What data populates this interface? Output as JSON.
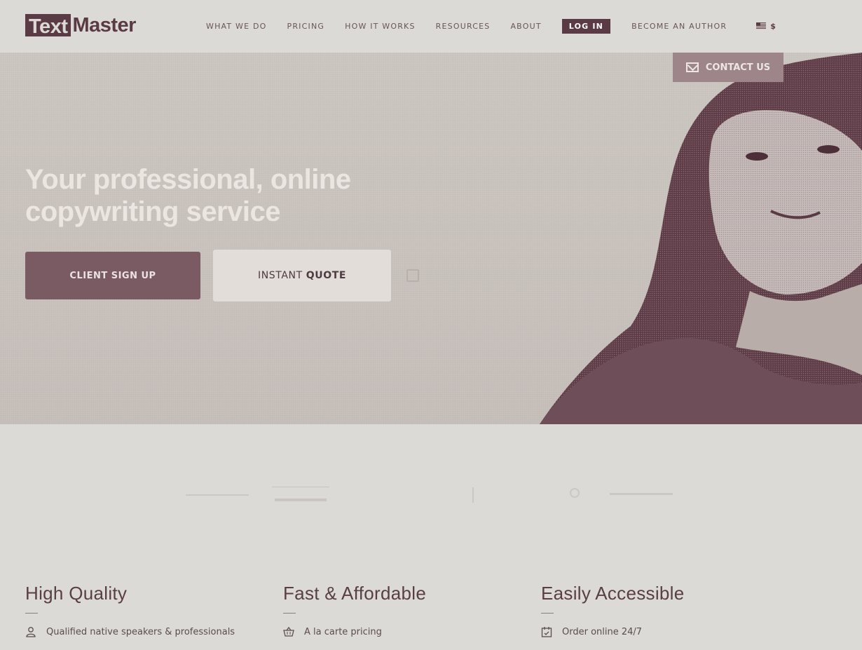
{
  "header": {
    "logo_left": "Text",
    "logo_right": "Master",
    "nav": [
      "WHAT WE DO",
      "PRICING",
      "HOW IT WORKS",
      "RESOURCES",
      "ABOUT"
    ],
    "login": "LOG IN",
    "become_author": "BECOME AN AUTHOR",
    "currency": "$"
  },
  "hero": {
    "contact": "CONTACT US",
    "title_line1": "Your professional, online",
    "title_line2": "copywriting service",
    "signup": "CLIENT SIGN UP",
    "quote_prefix": "INSTANT",
    "quote_bold": "QUOTE"
  },
  "features": [
    {
      "title": "High Quality",
      "item": "Qualified native speakers & professionals",
      "icon": "user-icon"
    },
    {
      "title": "Fast & Affordable",
      "item": "A la carte pricing",
      "icon": "basket-icon"
    },
    {
      "title": "Easily Accessible",
      "item": "Order online 24/7",
      "icon": "calendar-icon"
    }
  ],
  "colors": {
    "brand": "#5a3a45",
    "background": "#dcdad6",
    "hero_text": "#ebe6e2"
  }
}
